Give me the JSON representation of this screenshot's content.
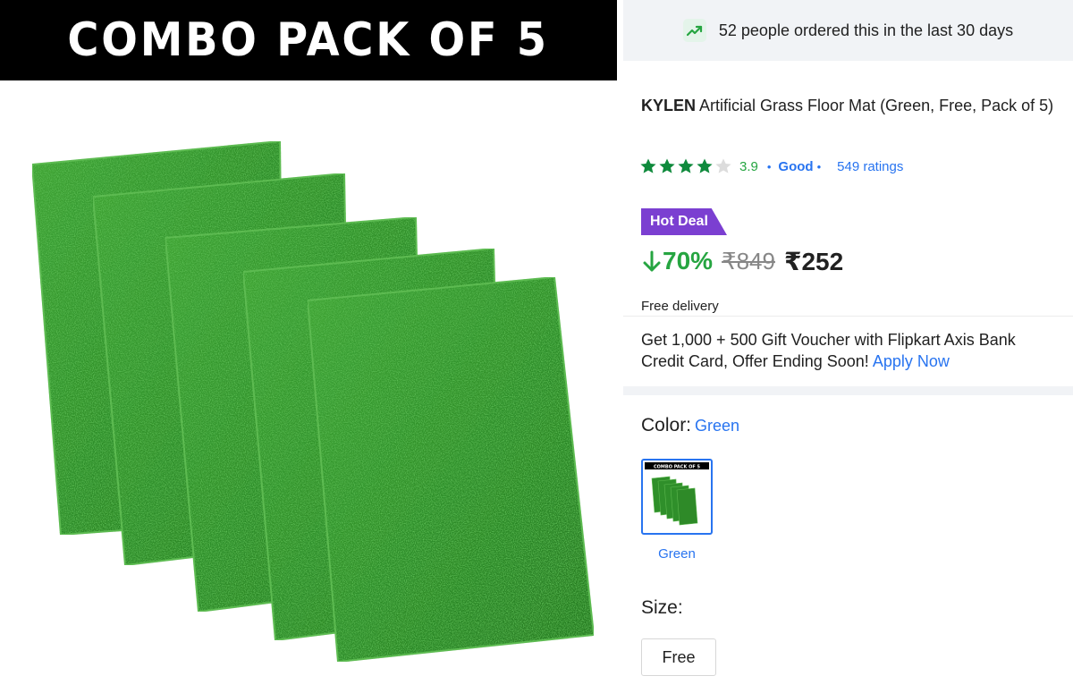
{
  "image": {
    "banner_text": "COMBO PACK OF 5",
    "product": "artificial grass mats, pack of 5",
    "mat_color": "#2f8f2a"
  },
  "social_proof": {
    "icon": "trending-up-icon",
    "text": "52 people ordered this in the last 30 days"
  },
  "product": {
    "brand": "KYLEN",
    "title": "Artificial Grass Floor Mat (Green, Free, Pack of 5)"
  },
  "rating": {
    "stars_filled": 4,
    "stars_total": 5,
    "value": "3.9",
    "separator": "•",
    "label": "Good",
    "label_separator": "•",
    "count": "549 ratings"
  },
  "deal": {
    "badge": "Hot Deal",
    "badge_color": "#7b3fd1",
    "discount": "70%",
    "discount_icon": "arrow-down-icon",
    "mrp": "₹849",
    "price": "₹252"
  },
  "delivery": {
    "text": "Free delivery"
  },
  "offer": {
    "text": "Get 1,000 + 500 Gift Voucher with Flipkart Axis Bank Credit Card, Offer Ending Soon!",
    "link": "Apply Now"
  },
  "color": {
    "label": "Color:",
    "selected": "Green",
    "options": [
      {
        "name": "Green",
        "thumb_banner": "COMBO PACK OF 5"
      }
    ]
  },
  "size": {
    "label": "Size:",
    "options": [
      "Free"
    ]
  },
  "colors": {
    "success_green": "#26a541",
    "link_blue": "#2874f0",
    "muted_gray": "#878787",
    "panel_bg": "#f1f3f6"
  }
}
